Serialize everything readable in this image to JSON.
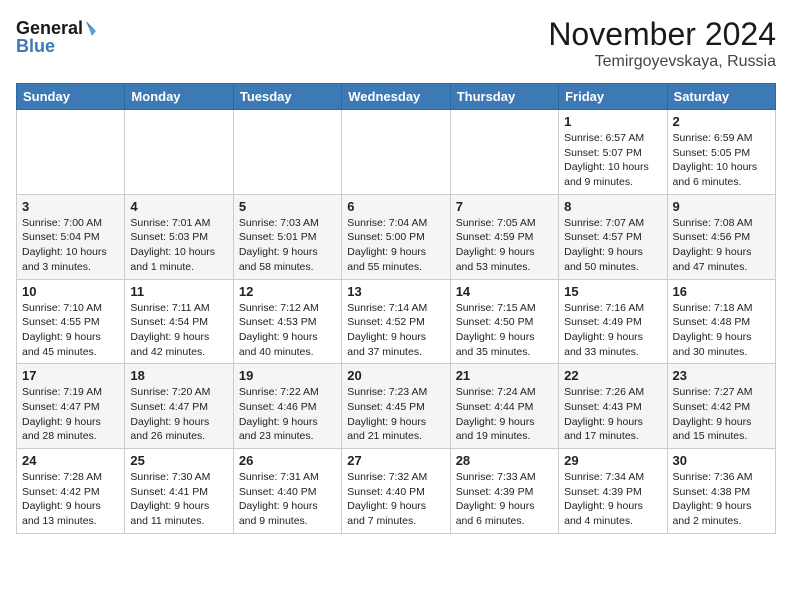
{
  "header": {
    "logo_line1": "General",
    "logo_line2": "Blue",
    "month": "November 2024",
    "location": "Temirgoyevskaya, Russia"
  },
  "weekdays": [
    "Sunday",
    "Monday",
    "Tuesday",
    "Wednesday",
    "Thursday",
    "Friday",
    "Saturday"
  ],
  "weeks": [
    [
      {
        "day": "",
        "info": ""
      },
      {
        "day": "",
        "info": ""
      },
      {
        "day": "",
        "info": ""
      },
      {
        "day": "",
        "info": ""
      },
      {
        "day": "",
        "info": ""
      },
      {
        "day": "1",
        "info": "Sunrise: 6:57 AM\nSunset: 5:07 PM\nDaylight: 10 hours and 9 minutes."
      },
      {
        "day": "2",
        "info": "Sunrise: 6:59 AM\nSunset: 5:05 PM\nDaylight: 10 hours and 6 minutes."
      }
    ],
    [
      {
        "day": "3",
        "info": "Sunrise: 7:00 AM\nSunset: 5:04 PM\nDaylight: 10 hours and 3 minutes."
      },
      {
        "day": "4",
        "info": "Sunrise: 7:01 AM\nSunset: 5:03 PM\nDaylight: 10 hours and 1 minute."
      },
      {
        "day": "5",
        "info": "Sunrise: 7:03 AM\nSunset: 5:01 PM\nDaylight: 9 hours and 58 minutes."
      },
      {
        "day": "6",
        "info": "Sunrise: 7:04 AM\nSunset: 5:00 PM\nDaylight: 9 hours and 55 minutes."
      },
      {
        "day": "7",
        "info": "Sunrise: 7:05 AM\nSunset: 4:59 PM\nDaylight: 9 hours and 53 minutes."
      },
      {
        "day": "8",
        "info": "Sunrise: 7:07 AM\nSunset: 4:57 PM\nDaylight: 9 hours and 50 minutes."
      },
      {
        "day": "9",
        "info": "Sunrise: 7:08 AM\nSunset: 4:56 PM\nDaylight: 9 hours and 47 minutes."
      }
    ],
    [
      {
        "day": "10",
        "info": "Sunrise: 7:10 AM\nSunset: 4:55 PM\nDaylight: 9 hours and 45 minutes."
      },
      {
        "day": "11",
        "info": "Sunrise: 7:11 AM\nSunset: 4:54 PM\nDaylight: 9 hours and 42 minutes."
      },
      {
        "day": "12",
        "info": "Sunrise: 7:12 AM\nSunset: 4:53 PM\nDaylight: 9 hours and 40 minutes."
      },
      {
        "day": "13",
        "info": "Sunrise: 7:14 AM\nSunset: 4:52 PM\nDaylight: 9 hours and 37 minutes."
      },
      {
        "day": "14",
        "info": "Sunrise: 7:15 AM\nSunset: 4:50 PM\nDaylight: 9 hours and 35 minutes."
      },
      {
        "day": "15",
        "info": "Sunrise: 7:16 AM\nSunset: 4:49 PM\nDaylight: 9 hours and 33 minutes."
      },
      {
        "day": "16",
        "info": "Sunrise: 7:18 AM\nSunset: 4:48 PM\nDaylight: 9 hours and 30 minutes."
      }
    ],
    [
      {
        "day": "17",
        "info": "Sunrise: 7:19 AM\nSunset: 4:47 PM\nDaylight: 9 hours and 28 minutes."
      },
      {
        "day": "18",
        "info": "Sunrise: 7:20 AM\nSunset: 4:47 PM\nDaylight: 9 hours and 26 minutes."
      },
      {
        "day": "19",
        "info": "Sunrise: 7:22 AM\nSunset: 4:46 PM\nDaylight: 9 hours and 23 minutes."
      },
      {
        "day": "20",
        "info": "Sunrise: 7:23 AM\nSunset: 4:45 PM\nDaylight: 9 hours and 21 minutes."
      },
      {
        "day": "21",
        "info": "Sunrise: 7:24 AM\nSunset: 4:44 PM\nDaylight: 9 hours and 19 minutes."
      },
      {
        "day": "22",
        "info": "Sunrise: 7:26 AM\nSunset: 4:43 PM\nDaylight: 9 hours and 17 minutes."
      },
      {
        "day": "23",
        "info": "Sunrise: 7:27 AM\nSunset: 4:42 PM\nDaylight: 9 hours and 15 minutes."
      }
    ],
    [
      {
        "day": "24",
        "info": "Sunrise: 7:28 AM\nSunset: 4:42 PM\nDaylight: 9 hours and 13 minutes."
      },
      {
        "day": "25",
        "info": "Sunrise: 7:30 AM\nSunset: 4:41 PM\nDaylight: 9 hours and 11 minutes."
      },
      {
        "day": "26",
        "info": "Sunrise: 7:31 AM\nSunset: 4:40 PM\nDaylight: 9 hours and 9 minutes."
      },
      {
        "day": "27",
        "info": "Sunrise: 7:32 AM\nSunset: 4:40 PM\nDaylight: 9 hours and 7 minutes."
      },
      {
        "day": "28",
        "info": "Sunrise: 7:33 AM\nSunset: 4:39 PM\nDaylight: 9 hours and 6 minutes."
      },
      {
        "day": "29",
        "info": "Sunrise: 7:34 AM\nSunset: 4:39 PM\nDaylight: 9 hours and 4 minutes."
      },
      {
        "day": "30",
        "info": "Sunrise: 7:36 AM\nSunset: 4:38 PM\nDaylight: 9 hours and 2 minutes."
      }
    ]
  ]
}
